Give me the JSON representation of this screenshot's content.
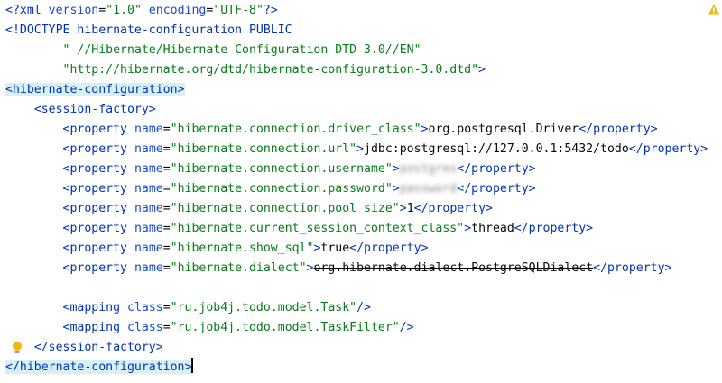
{
  "editor": {
    "lines": [
      {
        "indent": "",
        "segments": [
          {
            "cls": "t-pi",
            "text": "<?xml"
          },
          {
            "cls": "t-attr",
            "text": " version"
          },
          {
            "cls": "t-text",
            "text": "="
          },
          {
            "cls": "t-val",
            "text": "\"1.0\""
          },
          {
            "cls": "t-attr",
            "text": " encoding"
          },
          {
            "cls": "t-text",
            "text": "="
          },
          {
            "cls": "t-val",
            "text": "\"UTF-8\""
          },
          {
            "cls": "t-pi",
            "text": "?>"
          }
        ]
      },
      {
        "indent": "",
        "segments": [
          {
            "cls": "t-doctype",
            "text": "<!DOCTYPE hibernate-configuration PUBLIC"
          }
        ]
      },
      {
        "indent": "        ",
        "segments": [
          {
            "cls": "t-val",
            "text": "\"-//Hibernate/Hibernate Configuration DTD 3.0//EN\""
          }
        ]
      },
      {
        "indent": "        ",
        "segments": [
          {
            "cls": "t-val",
            "text": "\"http://hibernate.org/dtd/hibernate-configuration-3.0.dtd\""
          },
          {
            "cls": "t-doctype",
            "text": ">"
          }
        ]
      },
      {
        "indent": "",
        "hl": true,
        "segments": [
          {
            "cls": "t-tag hl",
            "text": "<hibernate-configuration>"
          }
        ]
      },
      {
        "indent": "    ",
        "segments": [
          {
            "cls": "t-tag",
            "text": "<session-factory>"
          }
        ]
      },
      {
        "indent": "        ",
        "segments": [
          {
            "cls": "t-tag",
            "text": "<property"
          },
          {
            "cls": "t-attr",
            "text": " name"
          },
          {
            "cls": "t-text",
            "text": "="
          },
          {
            "cls": "t-val",
            "text": "\"hibernate.connection.driver_class\""
          },
          {
            "cls": "t-tag",
            "text": ">"
          },
          {
            "cls": "t-text",
            "text": "org.postgresql.Driver"
          },
          {
            "cls": "t-tag",
            "text": "</property>"
          }
        ]
      },
      {
        "indent": "        ",
        "segments": [
          {
            "cls": "t-tag",
            "text": "<property"
          },
          {
            "cls": "t-attr",
            "text": " name"
          },
          {
            "cls": "t-text",
            "text": "="
          },
          {
            "cls": "t-val",
            "text": "\"hibernate.connection.url\""
          },
          {
            "cls": "t-tag",
            "text": ">"
          },
          {
            "cls": "t-text",
            "text": "jdbc:postgresql://127.0.0.1:5432/todo"
          },
          {
            "cls": "t-tag",
            "text": "</property>"
          }
        ]
      },
      {
        "indent": "        ",
        "segments": [
          {
            "cls": "t-tag",
            "text": "<property"
          },
          {
            "cls": "t-attr",
            "text": " name"
          },
          {
            "cls": "t-text",
            "text": "="
          },
          {
            "cls": "t-val",
            "text": "\"hibernate.connection.username\""
          },
          {
            "cls": "t-tag",
            "text": ">"
          },
          {
            "cls": "t-blur",
            "text": "postgres"
          },
          {
            "cls": "t-tag",
            "text": "</property>"
          }
        ]
      },
      {
        "indent": "        ",
        "segments": [
          {
            "cls": "t-tag",
            "text": "<property"
          },
          {
            "cls": "t-attr",
            "text": " name"
          },
          {
            "cls": "t-text",
            "text": "="
          },
          {
            "cls": "t-val",
            "text": "\"hibernate.connection.password\""
          },
          {
            "cls": "t-tag",
            "text": ">"
          },
          {
            "cls": "t-blur",
            "text": "password"
          },
          {
            "cls": "t-tag",
            "text": "</property>"
          }
        ]
      },
      {
        "indent": "        ",
        "segments": [
          {
            "cls": "t-tag",
            "text": "<property"
          },
          {
            "cls": "t-attr",
            "text": " name"
          },
          {
            "cls": "t-text",
            "text": "="
          },
          {
            "cls": "t-val",
            "text": "\"hibernate.connection.pool_size\""
          },
          {
            "cls": "t-tag",
            "text": ">"
          },
          {
            "cls": "t-text",
            "text": "1"
          },
          {
            "cls": "t-tag",
            "text": "</property>"
          }
        ]
      },
      {
        "indent": "        ",
        "segments": [
          {
            "cls": "t-tag",
            "text": "<property"
          },
          {
            "cls": "t-attr",
            "text": " name"
          },
          {
            "cls": "t-text",
            "text": "="
          },
          {
            "cls": "t-val",
            "text": "\"hibernate.current_session_context_class\""
          },
          {
            "cls": "t-tag",
            "text": ">"
          },
          {
            "cls": "t-text",
            "text": "thread"
          },
          {
            "cls": "t-tag",
            "text": "</property>"
          }
        ]
      },
      {
        "indent": "        ",
        "segments": [
          {
            "cls": "t-tag",
            "text": "<property"
          },
          {
            "cls": "t-attr",
            "text": " name"
          },
          {
            "cls": "t-text",
            "text": "="
          },
          {
            "cls": "t-val",
            "text": "\"hibernate.show_sql\""
          },
          {
            "cls": "t-tag",
            "text": ">"
          },
          {
            "cls": "t-text",
            "text": "true"
          },
          {
            "cls": "t-tag",
            "text": "</property>"
          }
        ]
      },
      {
        "indent": "        ",
        "segments": [
          {
            "cls": "t-tag",
            "text": "<property"
          },
          {
            "cls": "t-attr",
            "text": " name"
          },
          {
            "cls": "t-text",
            "text": "="
          },
          {
            "cls": "t-val",
            "text": "\"hibernate.dialect\""
          },
          {
            "cls": "t-tag",
            "text": ">"
          },
          {
            "cls": "t-text t-strike",
            "text": "org.hibernate.dialect.PostgreSQLDialect"
          },
          {
            "cls": "t-tag",
            "text": "</property>"
          }
        ]
      },
      {
        "indent": "",
        "segments": []
      },
      {
        "indent": "        ",
        "segments": [
          {
            "cls": "t-tag",
            "text": "<mapping"
          },
          {
            "cls": "t-attr",
            "text": " class"
          },
          {
            "cls": "t-text",
            "text": "="
          },
          {
            "cls": "t-val",
            "text": "\"ru.job4j.todo.model.Task\""
          },
          {
            "cls": "t-tag",
            "text": "/>"
          }
        ]
      },
      {
        "indent": "        ",
        "segments": [
          {
            "cls": "t-tag",
            "text": "<mapping"
          },
          {
            "cls": "t-attr",
            "text": " class"
          },
          {
            "cls": "t-text",
            "text": "="
          },
          {
            "cls": "t-val",
            "text": "\"ru.job4j.todo.model.TaskFilter\""
          },
          {
            "cls": "t-tag",
            "text": "/>"
          }
        ]
      },
      {
        "indent": "    ",
        "bulb": true,
        "segments": [
          {
            "cls": "t-tag",
            "text": "</session-factory>"
          }
        ]
      },
      {
        "indent": "",
        "caret": true,
        "segments": [
          {
            "cls": "t-tag hl",
            "text": "</hibernate-configuration>"
          }
        ]
      }
    ]
  },
  "colors": {
    "tag": "#0033b3",
    "attr": "#174ad4",
    "value": "#067d17",
    "highlight": "#d7f0f4",
    "warning": "#e8b91f"
  },
  "icons": {
    "warning": "warning-triangle-icon",
    "intention": "lightbulb-icon"
  }
}
